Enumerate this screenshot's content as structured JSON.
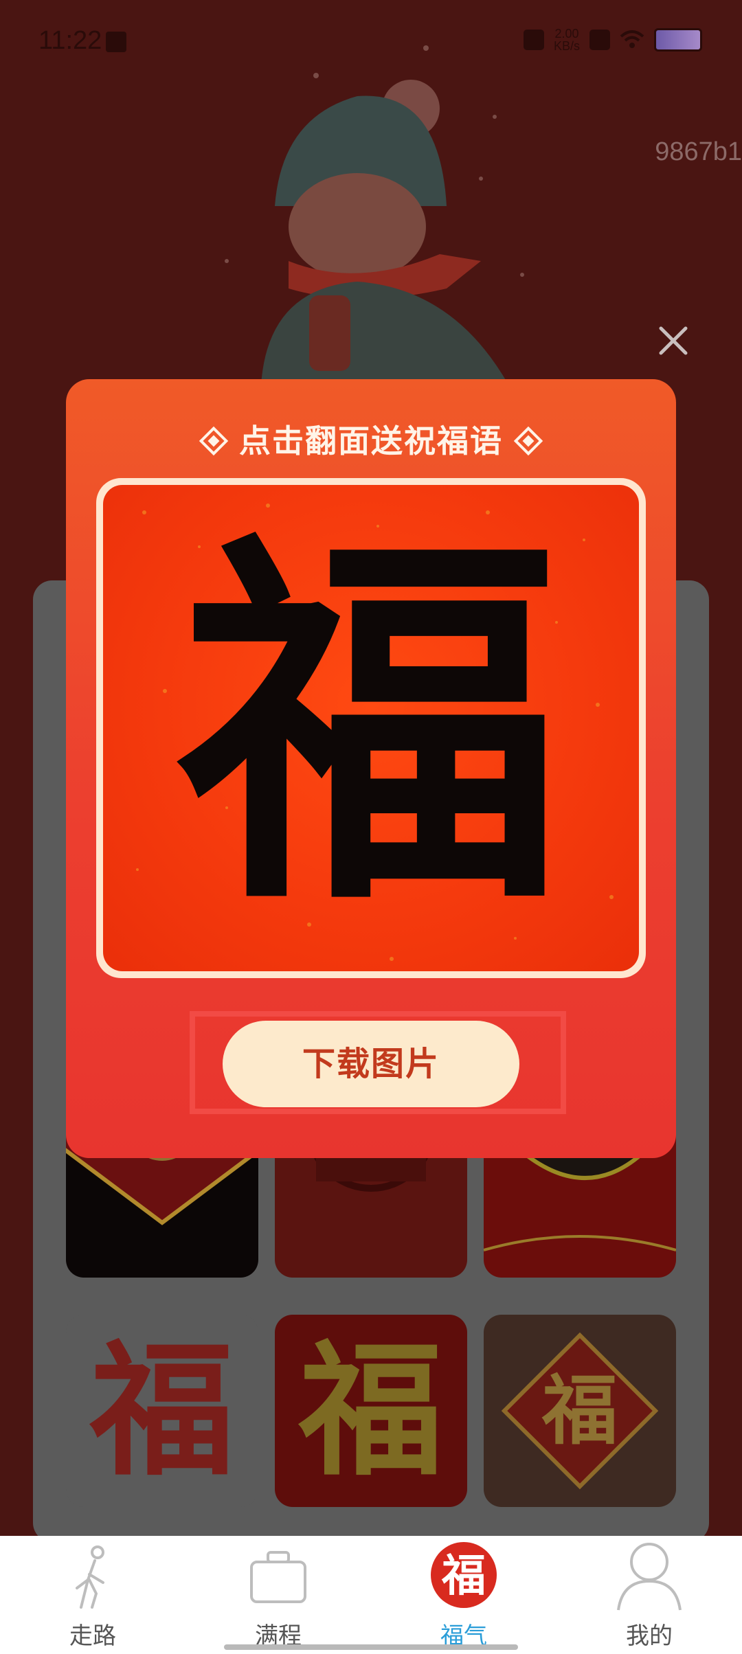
{
  "status_bar": {
    "time": "11:22",
    "net_speed_value": "2.00",
    "net_speed_unit": "KB/s",
    "icons": [
      "sim-icon",
      "mute-icon",
      "sim-off-icon",
      "wifi-icon",
      "battery-icon"
    ]
  },
  "hero": {
    "id_text": "9867b1"
  },
  "modal": {
    "title": "点击翻面送祝福语",
    "card_character": "福",
    "download_label": "下载图片"
  },
  "tabbar": {
    "tabs": [
      {
        "label": "走路",
        "icon": "walking-icon",
        "active": false
      },
      {
        "label": "满程",
        "icon": "suitcase-icon",
        "active": false
      },
      {
        "label": "福气",
        "icon": "fu-seal-icon",
        "active": true
      },
      {
        "label": "我的",
        "icon": "profile-icon",
        "active": false
      }
    ],
    "active_color": "#2a9dd8"
  },
  "colors": {
    "background": "#4a1512",
    "modal_top": "#f05a28",
    "modal_bottom": "#e8352f",
    "button_bg": "#fdeacc",
    "button_text": "#c23a1d"
  }
}
